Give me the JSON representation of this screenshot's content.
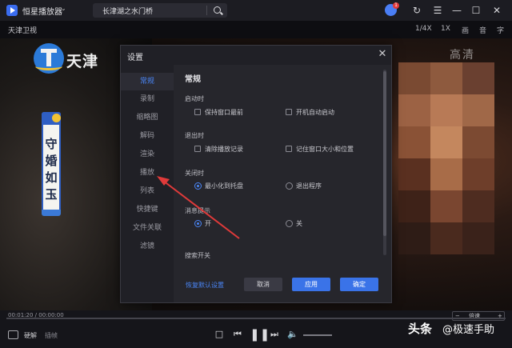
{
  "titlebar": {
    "app_name": "恒星播放器",
    "search_query": "长津湖之水门桥",
    "notification_count": "1"
  },
  "infobar": {
    "channel": "天津卫视",
    "ratio_label": "1/4X",
    "speed_label": "1X",
    "ctl_screen": "画",
    "ctl_sound": "音",
    "ctl_subtitle": "字"
  },
  "video": {
    "station_logo_text": "天津",
    "quality_text": "高清",
    "show_title": "守婚如玉"
  },
  "settings": {
    "title": "设置",
    "nav": [
      "常规",
      "录制",
      "缩略图",
      "解码",
      "渲染",
      "播放",
      "列表",
      "快捷键",
      "文件关联",
      "滤镜"
    ],
    "active_nav_index": 0,
    "section_title": "常规",
    "startup": {
      "label": "启动时",
      "keep_on_top": "保持窗口最前",
      "auto_start": "开机自动启动"
    },
    "on_exit": {
      "label": "退出时",
      "clear_history": "清除播放记录",
      "remember_window": "记住窗口大小和位置"
    },
    "on_close": {
      "label": "关闭时",
      "minimize_tray": "最小化到托盘",
      "exit_program": "退出程序",
      "selected": "最小化到托盘"
    },
    "message_prompt": {
      "label": "消息提示",
      "on": "开",
      "off": "关",
      "selected": "开"
    },
    "search_switch_label": "搜索开关",
    "restore_defaults": "恢复默认设置",
    "cancel": "取消",
    "apply": "应用",
    "confirm": "确定"
  },
  "controls": {
    "time": "00:01:20 / 00:00:00",
    "speed": "倍速",
    "speed_minus": "−",
    "speed_plus": "+",
    "hw_decode": "硬解",
    "plugin": "插帧",
    "progress_fraction": 0.0
  },
  "watermark": {
    "headline": "头条",
    "handle": "@极速手助"
  },
  "colors": {
    "accent": "#4a86f7",
    "annotation": "#e03a3a"
  }
}
